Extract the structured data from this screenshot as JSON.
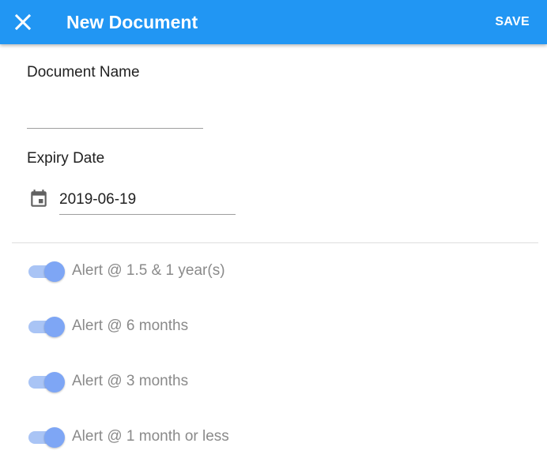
{
  "toolbar": {
    "close_icon": "close-icon",
    "title": "New Document",
    "save_label": "SAVE",
    "background_color": "#2196F3"
  },
  "form": {
    "document_name": {
      "label": "Document Name",
      "value": ""
    },
    "expiry_date": {
      "label": "Expiry Date",
      "icon": "calendar-icon",
      "value": "2019-06-19"
    }
  },
  "alerts": [
    {
      "label": "Alert @ 1.5 & 1 year(s)",
      "enabled": true
    },
    {
      "label": "Alert @ 6 months",
      "enabled": true
    },
    {
      "label": "Alert @ 3 months",
      "enabled": true
    },
    {
      "label": "Alert @ 1 month or less",
      "enabled": true
    }
  ],
  "colors": {
    "toggle_thumb": "#7ea6f5",
    "toggle_track": "#a9c4f5"
  }
}
